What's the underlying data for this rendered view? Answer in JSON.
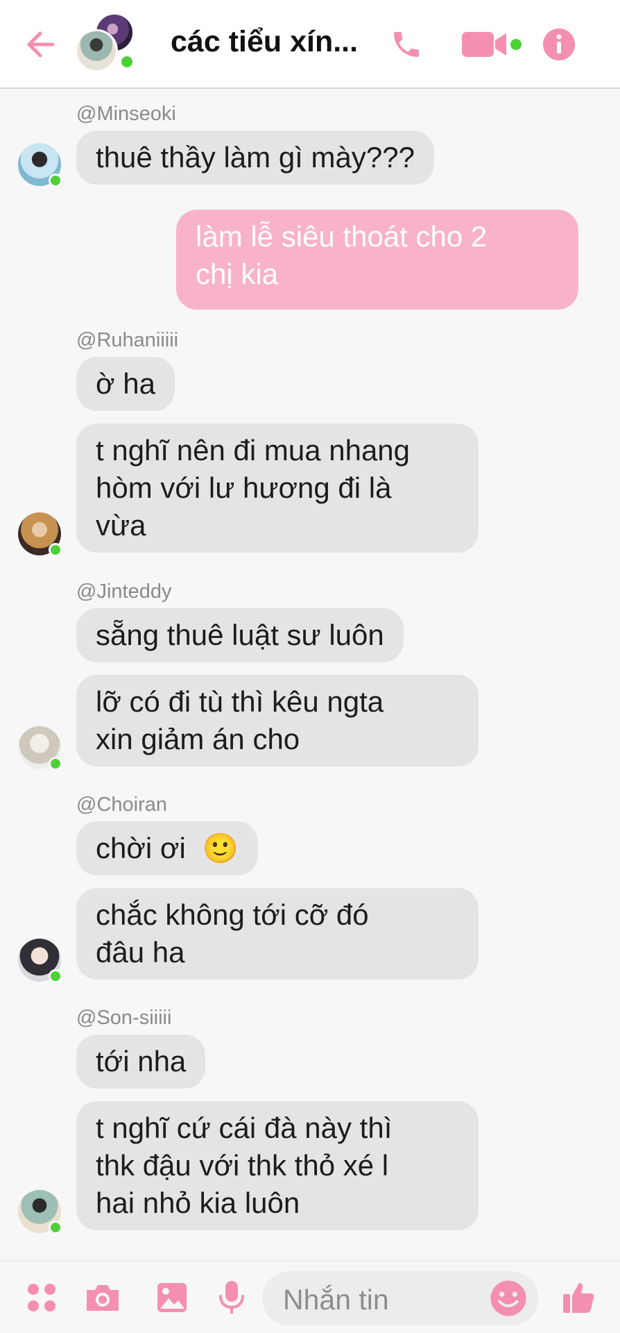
{
  "header": {
    "title": "các tiểu xín...",
    "back_icon": "back-arrow-icon",
    "call_icon": "phone-icon",
    "video_icon": "video-camera-icon",
    "info_icon": "info-icon",
    "accent_color": "#f48fb1"
  },
  "messages": [
    {
      "sender": "@Minseoki",
      "bubbles": [
        "thuê thầy làm gì mày???"
      ]
    },
    {
      "self": true,
      "lines": [
        "làm lễ siêu thoát cho 2",
        "chị kia"
      ]
    },
    {
      "sender": "@Ruhaniiiii",
      "bubbles": [
        "ờ ha"
      ],
      "multi": [
        "t nghĩ nên đi mua nhang",
        "hòm với lư hương đi là",
        "vừa"
      ]
    },
    {
      "sender": "@Jinteddy",
      "bubbles": [
        "sẵng thuê luật sư luôn"
      ],
      "multi": [
        "lỡ có đi tù thì kêu ngta",
        "xin giảm án cho"
      ]
    },
    {
      "sender": "@Choiran",
      "bubbles": [
        "chời ơi",
        "🙂"
      ],
      "multi": [
        "chắc không tới cỡ đó",
        "đâu ha"
      ]
    },
    {
      "sender": "@Son-siiiii",
      "bubbles": [
        "tới nha"
      ],
      "multi": [
        "t nghĩ cứ cái đà này thì",
        "thk đậu với thk thỏ xé l",
        "hai nhỏ kia luôn"
      ]
    }
  ],
  "composer": {
    "placeholder": "Nhắn tin",
    "icons": [
      "apps-grid-icon",
      "camera-icon",
      "image-icon",
      "microphone-icon",
      "emoji-icon",
      "thumbs-up-icon"
    ]
  },
  "colors": {
    "incoming_bubble": "#e4e4e4",
    "outgoing_bubble": "#f8b3cb",
    "online_dot": "#4cd137",
    "icon_pink": "#f48fb1"
  }
}
